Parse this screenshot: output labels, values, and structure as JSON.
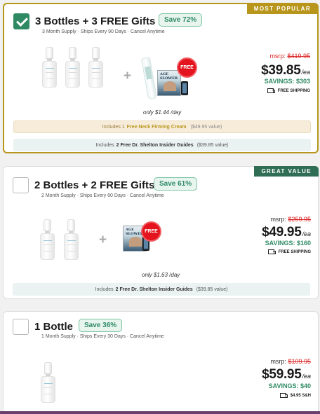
{
  "offers": [
    {
      "ribbon": "MOST POPULAR",
      "selected": true,
      "title": "3 Bottles + 3 FREE Gifts",
      "save_badge": "Save 72%",
      "subtitle": "3 Month Supply · Ships Every 90 Days · Cancel Anytime",
      "free_badge": "FREE",
      "book_title": "AGE SLOWER",
      "per_day": "only $1.44 /day",
      "msrp_label": "msrp:",
      "msrp_value": "$419.95",
      "price": "$39.85",
      "price_unit": "/ea",
      "savings": "SAVINGS: $303",
      "shipping": "FREE SHIPPING",
      "notes": [
        {
          "prefix": "Includes 1",
          "highlight": "Free Neck Firming Cream",
          "value": "($49.95 value)"
        },
        {
          "prefix": "Includes",
          "highlight": "2 Free Dr. Shelton Insider Guides",
          "value": "($39.85 value)"
        }
      ]
    },
    {
      "ribbon": "GREAT VALUE",
      "selected": false,
      "title": "2 Bottles + 2 FREE Gifts",
      "save_badge": "Save 61%",
      "subtitle": "2 Month Supply · Ships Every 60 Days · Cancel Anytime",
      "free_badge": "FREE",
      "book_title": "AGE SLOWER",
      "per_day": "only $1.63 /day",
      "msrp_label": "msrp:",
      "msrp_value": "$259.95",
      "price": "$49.95",
      "price_unit": "/ea",
      "savings": "SAVINGS: $160",
      "shipping": "FREE SHIPPING",
      "notes": [
        {
          "prefix": "Includes",
          "highlight": "2 Free Dr. Shelton Insider Guides",
          "value": "($39.85 value)"
        }
      ]
    },
    {
      "selected": false,
      "title": "1 Bottle",
      "save_badge": "Save 36%",
      "subtitle": "1 Month Supply · Ships Every 30 Days · Cancel Anytime",
      "msrp_label": "msrp:",
      "msrp_value": "$109.95",
      "price": "$59.95",
      "price_unit": "/ea",
      "savings": "SAVINGS: $40",
      "shipping": "$4.95 S&H"
    }
  ],
  "colors": {
    "accent_gold": "#b8961c",
    "accent_green": "#2f8a64",
    "ribbon_green": "#2f6e54",
    "strike_red": "#dd2222",
    "free_red": "#e3141d"
  },
  "icons": [
    "checkmark-icon",
    "truck-icon",
    "plus-icon"
  ]
}
